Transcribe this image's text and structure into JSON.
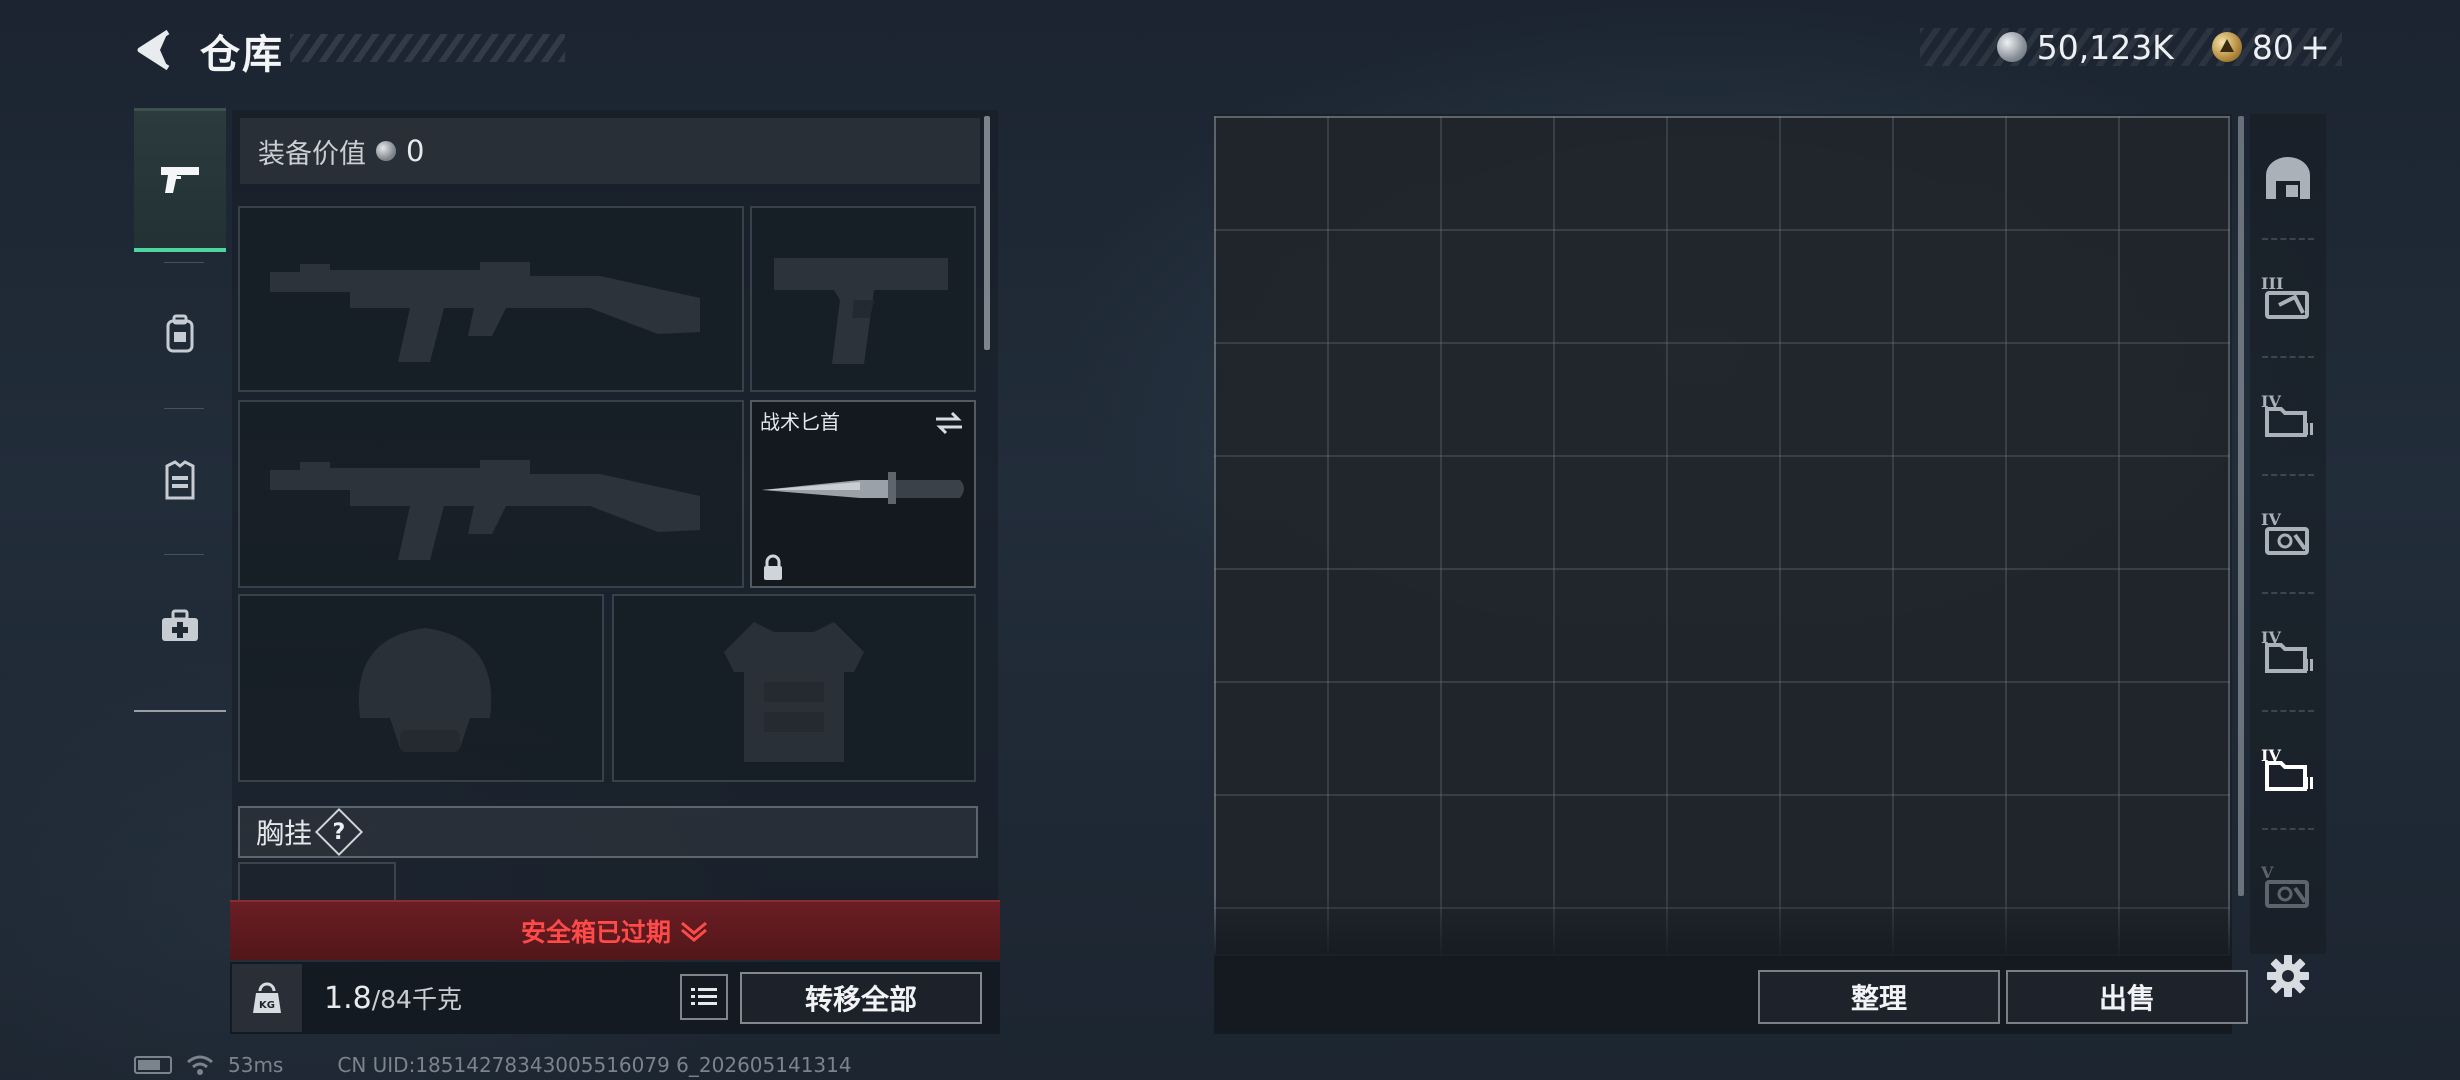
{
  "header": {
    "title": "仓库",
    "currency": [
      {
        "icon": "silver-coin-icon",
        "value": "50,123K"
      },
      {
        "icon": "gold-triangle-coin-icon",
        "value": "80"
      }
    ],
    "plus": "+"
  },
  "left_tabs": [
    {
      "icon": "pistol-icon",
      "active": true
    },
    {
      "icon": "backpack-icon",
      "active": false
    },
    {
      "icon": "vest-icon",
      "active": false
    },
    {
      "icon": "medkit-icon",
      "active": false
    }
  ],
  "equipment": {
    "value_label": "装备价值",
    "value": "0",
    "slots": [
      {
        "name": "primary-weapon-1",
        "icon": "rifle-silhouette-icon"
      },
      {
        "name": "sidearm",
        "icon": "pistol-silhouette-icon"
      },
      {
        "name": "primary-weapon-2",
        "icon": "rifle-silhouette-icon"
      },
      {
        "name": "melee",
        "label": "战术匕首",
        "icon": "knife-icon",
        "locked": true
      },
      {
        "name": "helmet",
        "icon": "helmet-silhouette-icon"
      },
      {
        "name": "armor",
        "icon": "armor-silhouette-icon"
      }
    ],
    "chest_rig_label": "胸挂",
    "help": "?",
    "safebox_status": "安全箱已过期",
    "weight_current": "1.8",
    "weight_capacity": "/84千克",
    "transfer_all": "转移全部"
  },
  "warehouse": {
    "sort_label": "整理",
    "sell_label": "出售"
  },
  "storage_tabs": [
    {
      "icon": "warehouse-home-icon",
      "label": ""
    },
    {
      "icon": "storage-box-icon",
      "label": "III"
    },
    {
      "icon": "folder-storage-icon",
      "label": "IV"
    },
    {
      "icon": "storage-box-icon",
      "label": "IV"
    },
    {
      "icon": "folder-storage-icon",
      "label": "IV"
    },
    {
      "icon": "folder-storage-icon",
      "label": "IV",
      "active": true
    },
    {
      "icon": "storage-box-icon",
      "label": "V"
    }
  ],
  "status": {
    "ping": "53ms",
    "uid": "CN UID:18514278343005516079 6_202605141314"
  },
  "colors": {
    "accent_green": "#4fd6a0",
    "alert_red": "#ff4a4a",
    "alert_bg": "#5e1a1f"
  }
}
